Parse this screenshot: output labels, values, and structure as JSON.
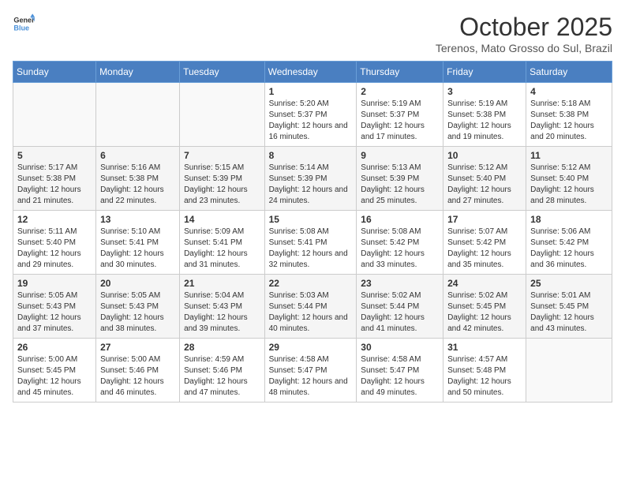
{
  "logo": {
    "line1": "General",
    "line2": "Blue"
  },
  "title": "October 2025",
  "location": "Terenos, Mato Grosso do Sul, Brazil",
  "weekdays": [
    "Sunday",
    "Monday",
    "Tuesday",
    "Wednesday",
    "Thursday",
    "Friday",
    "Saturday"
  ],
  "weeks": [
    [
      {
        "day": "",
        "sunrise": "",
        "sunset": "",
        "daylight": ""
      },
      {
        "day": "",
        "sunrise": "",
        "sunset": "",
        "daylight": ""
      },
      {
        "day": "",
        "sunrise": "",
        "sunset": "",
        "daylight": ""
      },
      {
        "day": "1",
        "sunrise": "Sunrise: 5:20 AM",
        "sunset": "Sunset: 5:37 PM",
        "daylight": "Daylight: 12 hours and 16 minutes."
      },
      {
        "day": "2",
        "sunrise": "Sunrise: 5:19 AM",
        "sunset": "Sunset: 5:37 PM",
        "daylight": "Daylight: 12 hours and 17 minutes."
      },
      {
        "day": "3",
        "sunrise": "Sunrise: 5:19 AM",
        "sunset": "Sunset: 5:38 PM",
        "daylight": "Daylight: 12 hours and 19 minutes."
      },
      {
        "day": "4",
        "sunrise": "Sunrise: 5:18 AM",
        "sunset": "Sunset: 5:38 PM",
        "daylight": "Daylight: 12 hours and 20 minutes."
      }
    ],
    [
      {
        "day": "5",
        "sunrise": "Sunrise: 5:17 AM",
        "sunset": "Sunset: 5:38 PM",
        "daylight": "Daylight: 12 hours and 21 minutes."
      },
      {
        "day": "6",
        "sunrise": "Sunrise: 5:16 AM",
        "sunset": "Sunset: 5:38 PM",
        "daylight": "Daylight: 12 hours and 22 minutes."
      },
      {
        "day": "7",
        "sunrise": "Sunrise: 5:15 AM",
        "sunset": "Sunset: 5:39 PM",
        "daylight": "Daylight: 12 hours and 23 minutes."
      },
      {
        "day": "8",
        "sunrise": "Sunrise: 5:14 AM",
        "sunset": "Sunset: 5:39 PM",
        "daylight": "Daylight: 12 hours and 24 minutes."
      },
      {
        "day": "9",
        "sunrise": "Sunrise: 5:13 AM",
        "sunset": "Sunset: 5:39 PM",
        "daylight": "Daylight: 12 hours and 25 minutes."
      },
      {
        "day": "10",
        "sunrise": "Sunrise: 5:12 AM",
        "sunset": "Sunset: 5:40 PM",
        "daylight": "Daylight: 12 hours and 27 minutes."
      },
      {
        "day": "11",
        "sunrise": "Sunrise: 5:12 AM",
        "sunset": "Sunset: 5:40 PM",
        "daylight": "Daylight: 12 hours and 28 minutes."
      }
    ],
    [
      {
        "day": "12",
        "sunrise": "Sunrise: 5:11 AM",
        "sunset": "Sunset: 5:40 PM",
        "daylight": "Daylight: 12 hours and 29 minutes."
      },
      {
        "day": "13",
        "sunrise": "Sunrise: 5:10 AM",
        "sunset": "Sunset: 5:41 PM",
        "daylight": "Daylight: 12 hours and 30 minutes."
      },
      {
        "day": "14",
        "sunrise": "Sunrise: 5:09 AM",
        "sunset": "Sunset: 5:41 PM",
        "daylight": "Daylight: 12 hours and 31 minutes."
      },
      {
        "day": "15",
        "sunrise": "Sunrise: 5:08 AM",
        "sunset": "Sunset: 5:41 PM",
        "daylight": "Daylight: 12 hours and 32 minutes."
      },
      {
        "day": "16",
        "sunrise": "Sunrise: 5:08 AM",
        "sunset": "Sunset: 5:42 PM",
        "daylight": "Daylight: 12 hours and 33 minutes."
      },
      {
        "day": "17",
        "sunrise": "Sunrise: 5:07 AM",
        "sunset": "Sunset: 5:42 PM",
        "daylight": "Daylight: 12 hours and 35 minutes."
      },
      {
        "day": "18",
        "sunrise": "Sunrise: 5:06 AM",
        "sunset": "Sunset: 5:42 PM",
        "daylight": "Daylight: 12 hours and 36 minutes."
      }
    ],
    [
      {
        "day": "19",
        "sunrise": "Sunrise: 5:05 AM",
        "sunset": "Sunset: 5:43 PM",
        "daylight": "Daylight: 12 hours and 37 minutes."
      },
      {
        "day": "20",
        "sunrise": "Sunrise: 5:05 AM",
        "sunset": "Sunset: 5:43 PM",
        "daylight": "Daylight: 12 hours and 38 minutes."
      },
      {
        "day": "21",
        "sunrise": "Sunrise: 5:04 AM",
        "sunset": "Sunset: 5:43 PM",
        "daylight": "Daylight: 12 hours and 39 minutes."
      },
      {
        "day": "22",
        "sunrise": "Sunrise: 5:03 AM",
        "sunset": "Sunset: 5:44 PM",
        "daylight": "Daylight: 12 hours and 40 minutes."
      },
      {
        "day": "23",
        "sunrise": "Sunrise: 5:02 AM",
        "sunset": "Sunset: 5:44 PM",
        "daylight": "Daylight: 12 hours and 41 minutes."
      },
      {
        "day": "24",
        "sunrise": "Sunrise: 5:02 AM",
        "sunset": "Sunset: 5:45 PM",
        "daylight": "Daylight: 12 hours and 42 minutes."
      },
      {
        "day": "25",
        "sunrise": "Sunrise: 5:01 AM",
        "sunset": "Sunset: 5:45 PM",
        "daylight": "Daylight: 12 hours and 43 minutes."
      }
    ],
    [
      {
        "day": "26",
        "sunrise": "Sunrise: 5:00 AM",
        "sunset": "Sunset: 5:45 PM",
        "daylight": "Daylight: 12 hours and 45 minutes."
      },
      {
        "day": "27",
        "sunrise": "Sunrise: 5:00 AM",
        "sunset": "Sunset: 5:46 PM",
        "daylight": "Daylight: 12 hours and 46 minutes."
      },
      {
        "day": "28",
        "sunrise": "Sunrise: 4:59 AM",
        "sunset": "Sunset: 5:46 PM",
        "daylight": "Daylight: 12 hours and 47 minutes."
      },
      {
        "day": "29",
        "sunrise": "Sunrise: 4:58 AM",
        "sunset": "Sunset: 5:47 PM",
        "daylight": "Daylight: 12 hours and 48 minutes."
      },
      {
        "day": "30",
        "sunrise": "Sunrise: 4:58 AM",
        "sunset": "Sunset: 5:47 PM",
        "daylight": "Daylight: 12 hours and 49 minutes."
      },
      {
        "day": "31",
        "sunrise": "Sunrise: 4:57 AM",
        "sunset": "Sunset: 5:48 PM",
        "daylight": "Daylight: 12 hours and 50 minutes."
      },
      {
        "day": "",
        "sunrise": "",
        "sunset": "",
        "daylight": ""
      }
    ]
  ]
}
